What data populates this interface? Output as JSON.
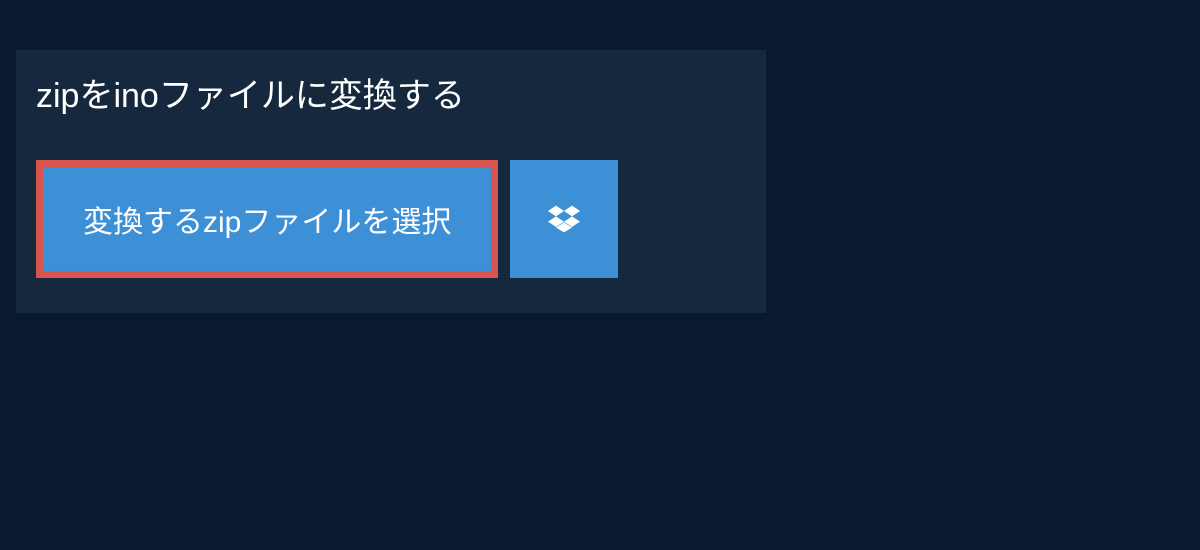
{
  "header": {
    "title": "zipをinoファイルに変換する"
  },
  "actions": {
    "select_file_label": "変換するzipファイルを選択"
  },
  "colors": {
    "background": "#0a1a2e",
    "panel": "#16283d",
    "button_primary": "#3d8fd6",
    "button_border": "#d9544f",
    "text": "#ffffff"
  }
}
